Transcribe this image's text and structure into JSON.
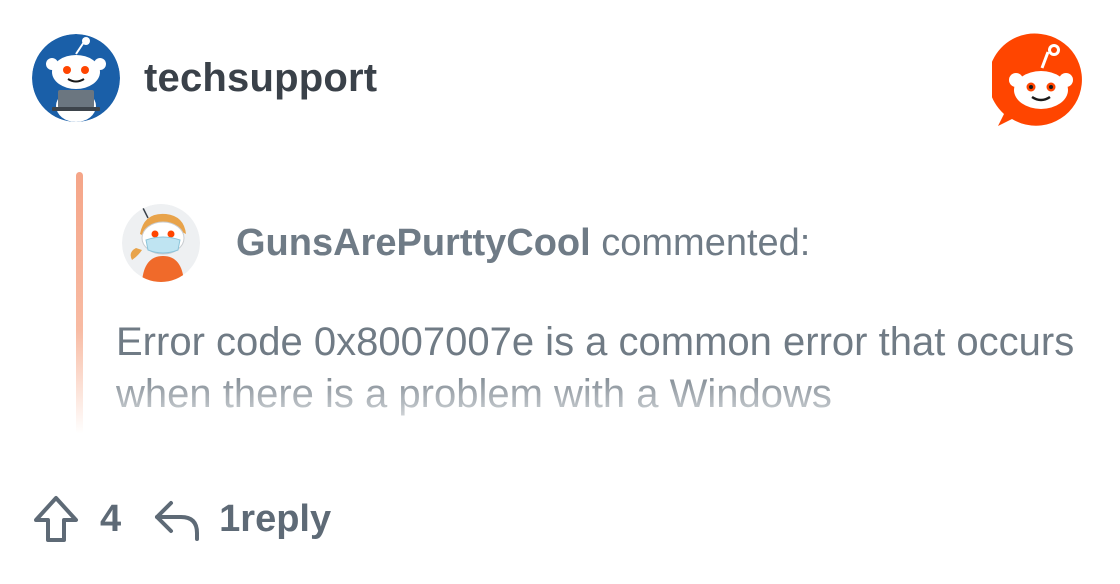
{
  "header": {
    "subreddit_name": "techsupport",
    "subreddit_avatar_icon": "snoo-at-computer-icon",
    "brand_icon": "reddit-logo-icon"
  },
  "comment": {
    "username": "GunsArePurttyCool",
    "action_text": " commented:",
    "avatar_icon": "masked-snoo-avatar-icon",
    "body": "Error code 0x8007007e is a common error that occurs when there is a problem with a Windows"
  },
  "footer": {
    "upvote_icon": "upvote-arrow-icon",
    "vote_count": "4",
    "reply_icon": "reply-arrow-icon",
    "reply_label": "1reply"
  },
  "colors": {
    "brand_orange": "#ff4500",
    "quote_bar": "#f5a588",
    "text_dark": "#3a4149",
    "text_muted": "#6f7b86"
  }
}
